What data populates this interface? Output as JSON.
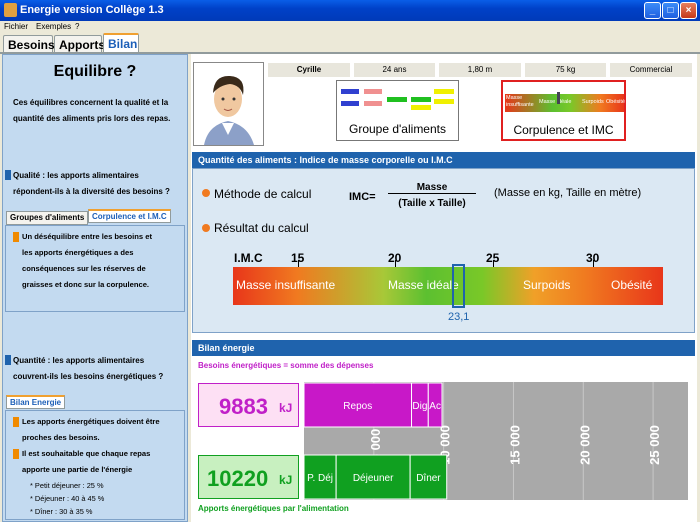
{
  "window": {
    "title": "Energie version Collège 1.3"
  },
  "menu": [
    "Fichier",
    "Exemples",
    "?"
  ],
  "tabs": [
    "Besoins",
    "Apports",
    "Bilan"
  ],
  "left": {
    "title": "Equilibre ?",
    "intro_1": "Ces équilibres concernent la qualité et la",
    "intro_2": "quantité des aliments pris lors des repas.",
    "qualite_1": "Qualité : les apports alimentaires",
    "qualite_2": "répondent-ils à la diversité des besoins ?",
    "subtabs": [
      "Groupes d'aliments",
      "Corpulence et I.M.C"
    ],
    "panel1": [
      "Un déséquilibre entre les besoins et",
      "les apports énergétiques a des",
      "conséquences sur les réserves de",
      "graisses et donc sur la corpulence."
    ],
    "quantite_1": "Quantité : les apports alimentaires",
    "quantite_2": "couvrent-ils les besoins énergétiques ?",
    "subtab2": "Bilan Energie",
    "panel2_a": [
      "Les apports énergétiques doivent être",
      "proches des besoins."
    ],
    "panel2_b": [
      "Il est souhaitable que chaque repas",
      "apporte une partie de l'énergie"
    ],
    "panel2_list": [
      "* Petit déjeuner : 25 %",
      "* Déjeuner : 40 à 45 %",
      "* Dîner : 30 à 35 %"
    ]
  },
  "person": {
    "name": "Cyrille",
    "age": "24 ans",
    "height": "1,80 m",
    "weight": "75 kg",
    "job": "Commercial"
  },
  "groups_label": "Groupe d'aliments",
  "corpulence": {
    "label": "Corpulence et IMC",
    "mini": [
      "Masse insuffisante",
      "Masse idéale",
      "Surpoids",
      "Obésité"
    ]
  },
  "imc_section": {
    "header": "Quantité des aliments : Indice de masse corporelle ou I.M.C",
    "method_label": "Méthode de calcul",
    "formula_prefix": "IMC=",
    "formula_num": "Masse",
    "formula_den": "(Taille x Taille)",
    "units": "(Masse en kg, Taille en mètre)",
    "result_label": "Résultat du calcul",
    "axis_title": "I.M.C",
    "ticks": [
      "15",
      "20",
      "25",
      "30"
    ],
    "zones": [
      "Masse insuffisante",
      "Masse idéale",
      "Surpoids",
      "Obésité"
    ],
    "value": "23,1"
  },
  "bilan": {
    "header": "Bilan énergie",
    "besoins_label": "Besoins énergétiques = somme des dépenses",
    "besoins_value": "9883",
    "apports_value": "10220",
    "unit": "kJ",
    "apports_label": "Apports énergétiques par l'alimentation",
    "colors": {
      "besoins": "#c020c8",
      "apports": "#10a020"
    }
  },
  "chart_data": {
    "type": "bar",
    "orientation": "horizontal-stacked",
    "xlim": [
      0,
      27500
    ],
    "ticks": [
      "5 000",
      "10 000",
      "15 000",
      "20 000",
      "25 000"
    ],
    "tick_values": [
      5000,
      10000,
      15000,
      20000,
      25000
    ],
    "series": [
      {
        "name": "Besoins",
        "segments": [
          {
            "label": "Repos",
            "value": 7700
          },
          {
            "label": "Dig",
            "value": 1200
          },
          {
            "label": "Ac",
            "value": 983
          }
        ]
      },
      {
        "name": "Apports",
        "segments": [
          {
            "label": "P. Déj",
            "value": 2300
          },
          {
            "label": "Déjeuner",
            "value": 5300
          },
          {
            "label": "Dîner",
            "value": 2620
          }
        ]
      }
    ]
  }
}
